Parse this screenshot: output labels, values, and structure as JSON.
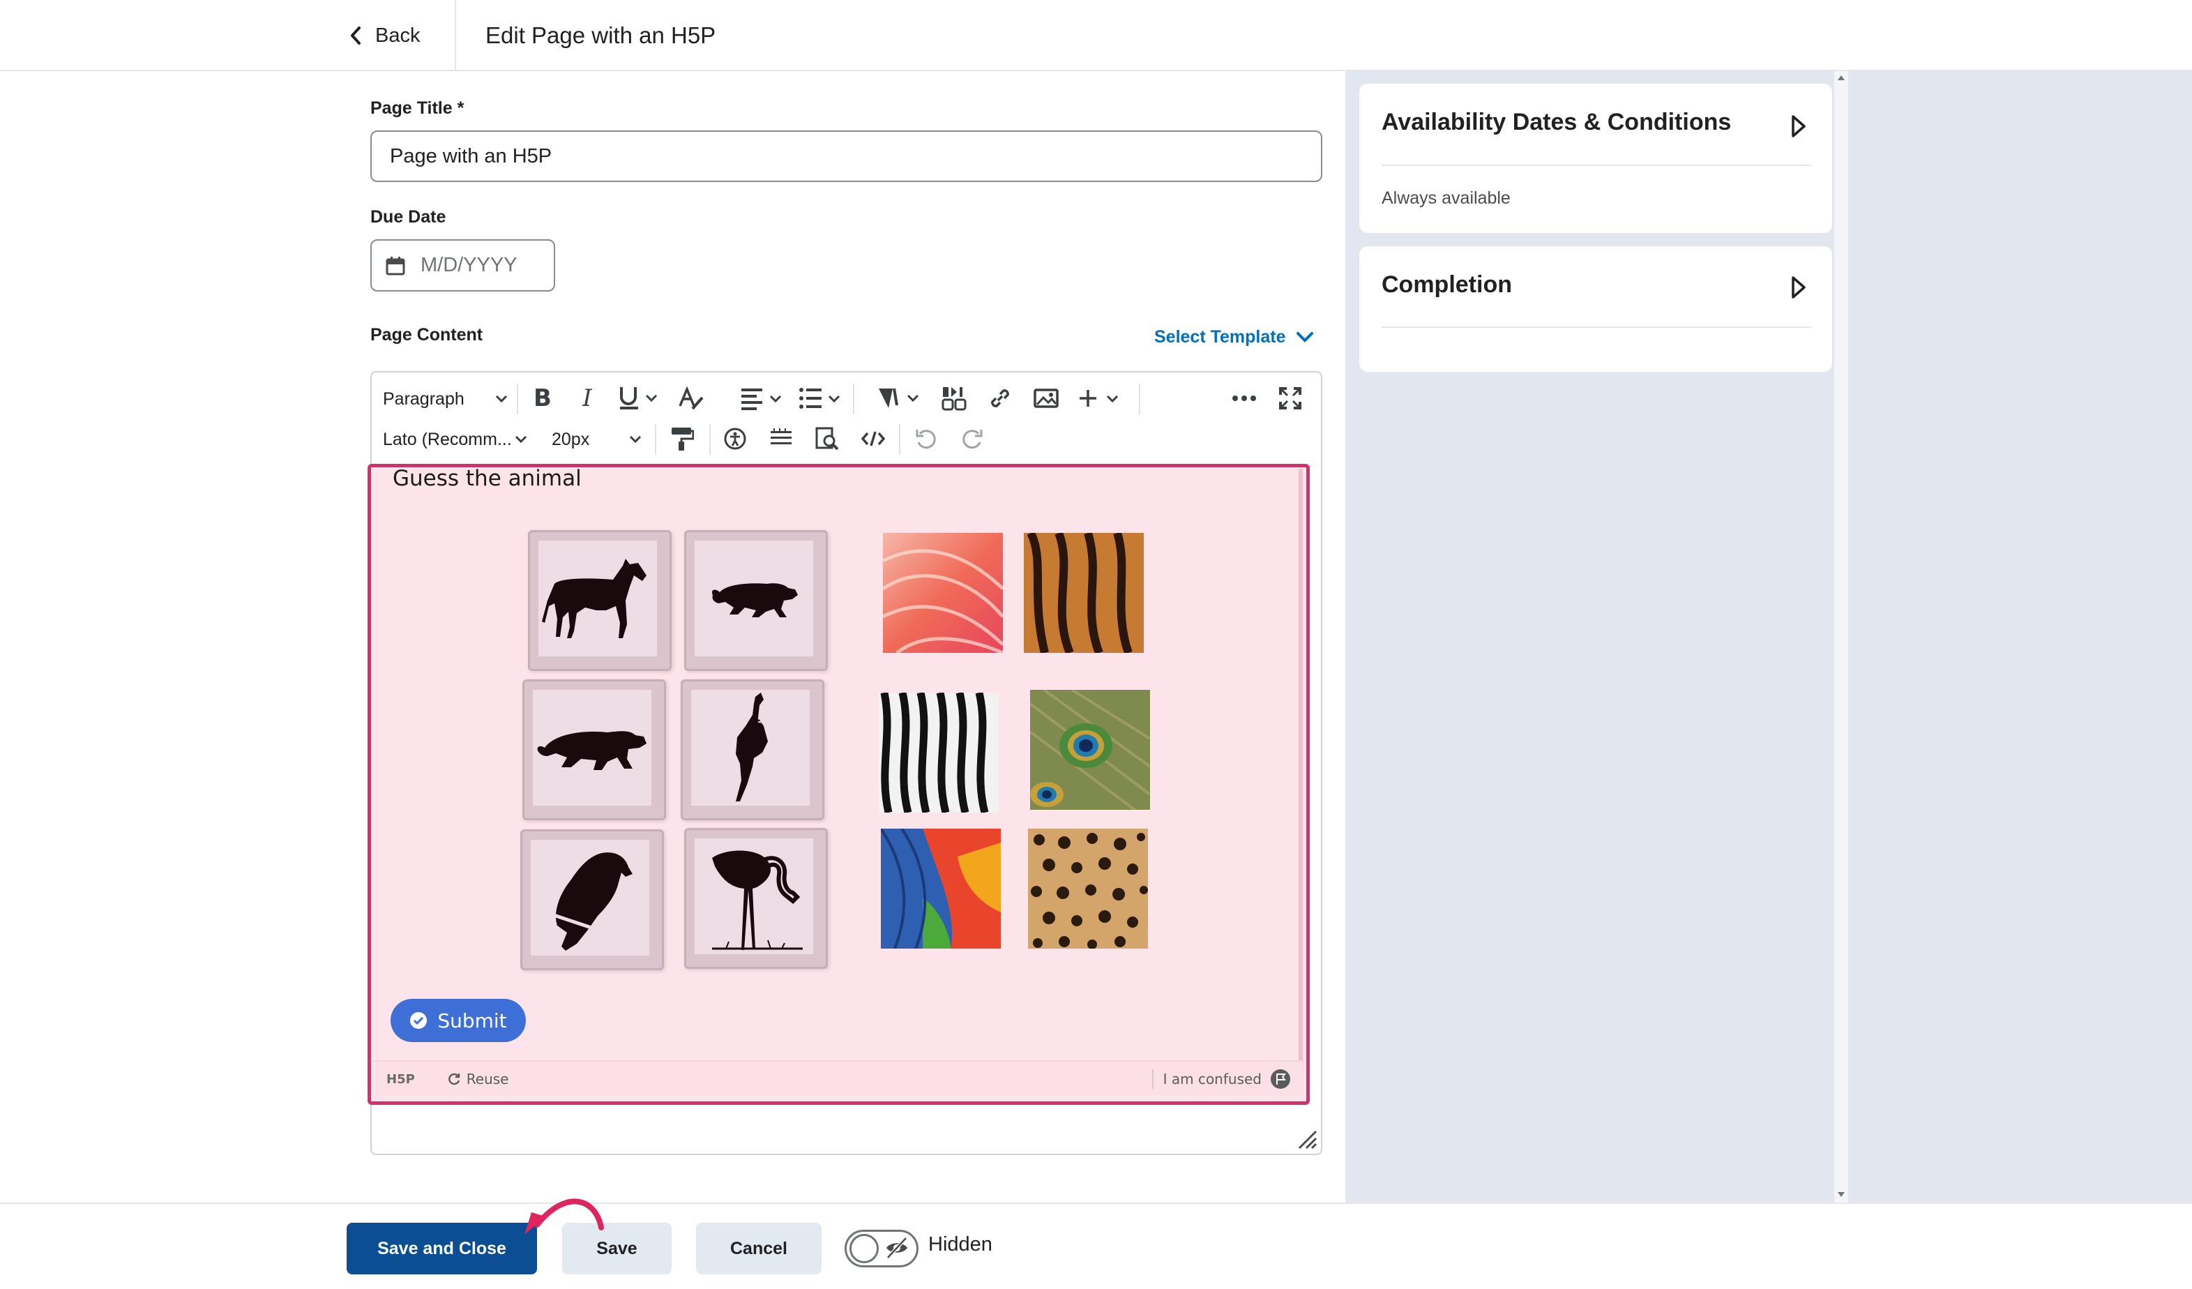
{
  "header": {
    "back_label": "Back",
    "title": "Edit Page with an H5P"
  },
  "form": {
    "page_title_label": "Page Title *",
    "page_title_value": "Page with an H5P",
    "due_date_label": "Due Date",
    "due_date_placeholder": "M/D/YYYY",
    "page_content_label": "Page Content",
    "select_template_label": "Select Template"
  },
  "toolbar": {
    "block_format": "Paragraph",
    "font_family": "Lato (Recomm...",
    "font_size": "20px"
  },
  "h5p": {
    "activity_title": "Guess the animal",
    "submit_label": "Submit",
    "brand_label": "H5P",
    "reuse_label": "Reuse",
    "confused_label": "I am confused",
    "silhouettes": [
      "horse",
      "panther",
      "tiger",
      "peacock",
      "parrot",
      "flamingo"
    ],
    "textures": [
      "flamingo-feathers",
      "tiger-fur",
      "zebra-stripes",
      "peacock-feathers",
      "parrot-feathers",
      "leopard-spots"
    ]
  },
  "right_panel": {
    "availability_title": "Availability Dates & Conditions",
    "availability_status": "Always available",
    "completion_title": "Completion"
  },
  "footer": {
    "save_close_label": "Save and Close",
    "save_label": "Save",
    "cancel_label": "Cancel",
    "visibility_label": "Hidden"
  },
  "colors": {
    "primary": "#0b4e93",
    "link": "#006fbf",
    "h5p_frame": "#d62f6b",
    "h5p_background": "#fde4ea",
    "submit": "#3d6fd6",
    "panel_background": "#e2e7ef",
    "annotation_arrow": "#e0245e"
  }
}
